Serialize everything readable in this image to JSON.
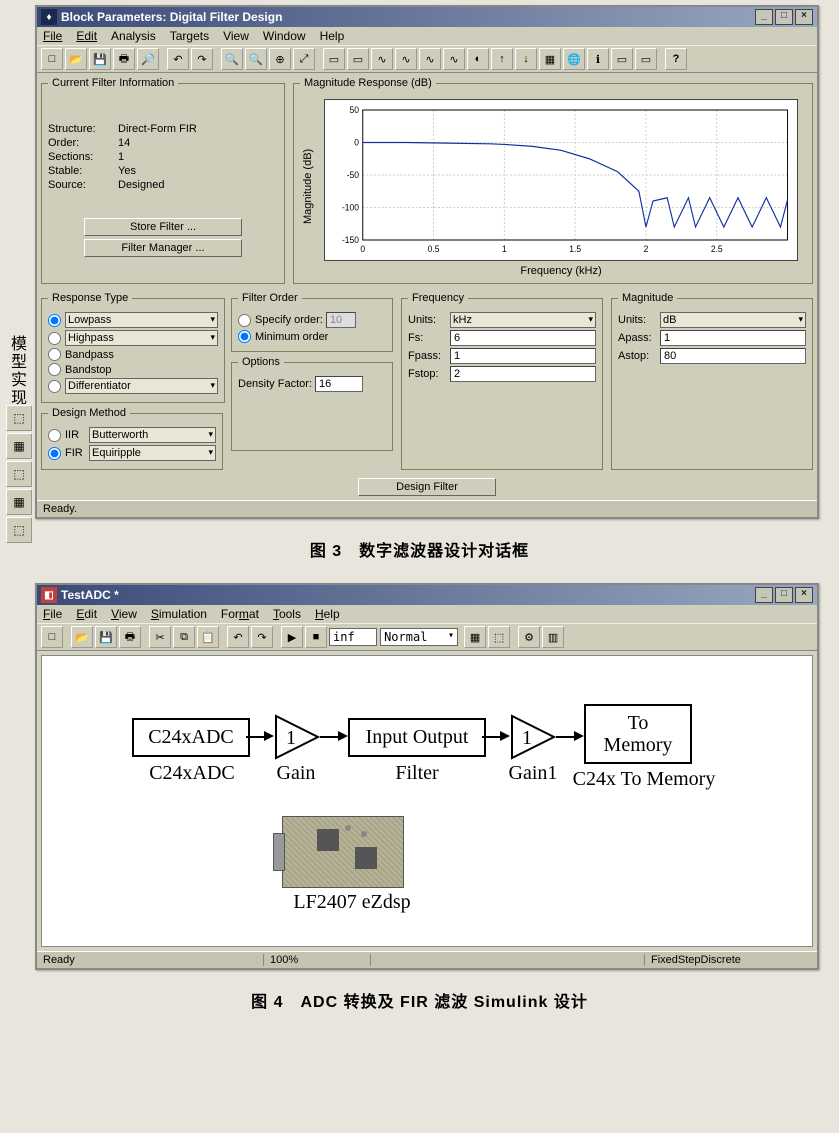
{
  "side_label": "模型实现",
  "win1": {
    "title": "Block Parameters: Digital Filter Design",
    "menu": [
      "File",
      "Edit",
      "Analysis",
      "Targets",
      "View",
      "Window",
      "Help"
    ],
    "filter_info": {
      "legend": "Current Filter Information",
      "rows": [
        {
          "lab": "Structure:",
          "val": "Direct-Form FIR"
        },
        {
          "lab": "Order:",
          "val": "14"
        },
        {
          "lab": "Sections:",
          "val": "1"
        },
        {
          "lab": "Stable:",
          "val": "Yes"
        },
        {
          "lab": "Source:",
          "val": "Designed"
        }
      ],
      "store_btn": "Store Filter ...",
      "manager_btn": "Filter Manager ..."
    },
    "mag_panel": {
      "legend": "Magnitude Response (dB)",
      "ylabel": "Magnitude (dB)",
      "xlabel": "Frequency (kHz)"
    },
    "resp_type": {
      "legend": "Response Type",
      "lowpass": "Lowpass",
      "highpass": "Highpass",
      "bandpass": "Bandpass",
      "bandstop": "Bandstop",
      "diff": "Differentiator"
    },
    "design_method": {
      "legend": "Design Method",
      "iir": "IIR",
      "iir_sel": "Butterworth",
      "fir": "FIR",
      "fir_sel": "Equiripple"
    },
    "filter_order": {
      "legend": "Filter Order",
      "specify": "Specify order:",
      "specify_val": "10",
      "minimum": "Minimum order"
    },
    "options": {
      "legend": "Options",
      "density": "Density Factor:",
      "density_val": "16"
    },
    "frequency": {
      "legend": "Frequency",
      "units_lab": "Units:",
      "units_val": "kHz",
      "fs_lab": "Fs:",
      "fs_val": "6",
      "fpass_lab": "Fpass:",
      "fpass_val": "1",
      "fstop_lab": "Fstop:",
      "fstop_val": "2"
    },
    "magnitude": {
      "legend": "Magnitude",
      "units_lab": "Units:",
      "units_val": "dB",
      "apass_lab": "Apass:",
      "apass_val": "1",
      "astop_lab": "Astop:",
      "astop_val": "80"
    },
    "design_btn": "Design Filter",
    "status": "Ready."
  },
  "caption1": "图 3　数字滤波器设计对话框",
  "win2": {
    "title": "TestADC *",
    "menu": [
      "File",
      "Edit",
      "View",
      "Simulation",
      "Format",
      "Tools",
      "Help"
    ],
    "stoptime": "inf",
    "mode": "Normal",
    "blocks": {
      "adc": "C24xADC",
      "adc_lab": "C24xADC",
      "gain": "1",
      "gain_lab": "Gain",
      "filter": "Input Output",
      "filter_lab": "Filter",
      "gain1": "1",
      "gain1_lab": "Gain1",
      "tomem_line1": "To",
      "tomem_line2": "Memory",
      "tomem_lab": "C24x To Memory",
      "dsp_lab": "LF2407 eZdsp"
    },
    "status_ready": "Ready",
    "status_zoom": "100%",
    "status_solver": "FixedStepDiscrete"
  },
  "caption2": "图 4　ADC 转换及 FIR 滤波 Simulink 设计",
  "chart_data": {
    "type": "line",
    "title": "Magnitude Response (dB)",
    "xlabel": "Frequency (kHz)",
    "ylabel": "Magnitude (dB)",
    "xlim": [
      0,
      3
    ],
    "ylim": [
      -150,
      50
    ],
    "xticks": [
      0,
      0.5,
      1,
      1.5,
      2,
      2.5
    ],
    "yticks": [
      -150,
      -100,
      -50,
      0,
      50
    ],
    "series": [
      {
        "name": "Magnitude",
        "x": [
          0,
          0.3,
          0.6,
          0.9,
          1.0,
          1.2,
          1.4,
          1.6,
          1.8,
          1.95,
          2.0,
          2.05,
          2.15,
          2.2,
          2.3,
          2.35,
          2.45,
          2.55,
          2.65,
          2.75,
          2.85,
          2.95,
          3.0
        ],
        "y": [
          0,
          0,
          -1,
          -2,
          -3,
          -6,
          -12,
          -25,
          -45,
          -75,
          -130,
          -90,
          -85,
          -130,
          -85,
          -130,
          -85,
          -130,
          -85,
          -130,
          -85,
          -130,
          -88
        ]
      }
    ]
  }
}
